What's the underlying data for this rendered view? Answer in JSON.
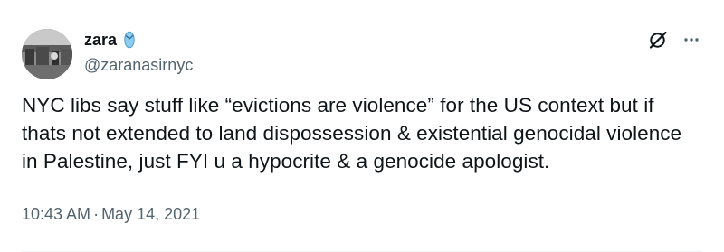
{
  "author": {
    "display_name": "zara",
    "handle": "@zaranasirnyc",
    "name_emoji": "flip-flop-icon",
    "avatar": "profile-photo"
  },
  "tweet": {
    "text": "NYC libs say stuff like “evictions are violence” for the US context but if thats not extended to land dispossession & existential genocidal violence in Palestine, just FYI u a hypocrite & a genocide apologist.",
    "time": "10:43 AM",
    "separator": "·",
    "date": "May 14, 2021"
  },
  "actions": {
    "grok_icon": "grok-icon",
    "more_icon": "more-icon"
  },
  "colors": {
    "text_primary": "#0f1419",
    "text_secondary": "#536471",
    "divider": "#eff3f4",
    "flipflop": "#8ecdf0"
  }
}
